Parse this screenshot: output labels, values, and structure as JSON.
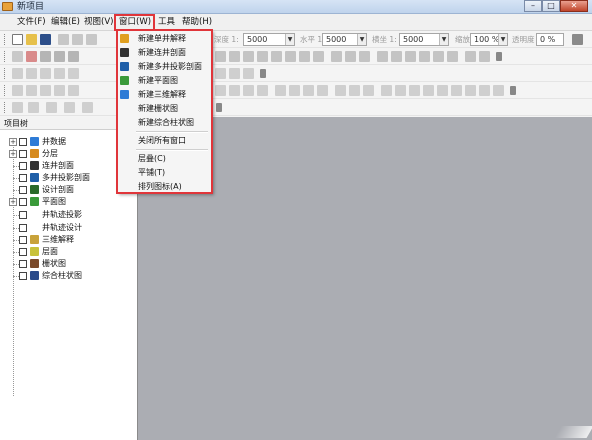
{
  "window": {
    "title": "新项目"
  },
  "menubar": {
    "items": [
      "文件(F)",
      "编辑(E)",
      "视图(V)",
      "窗口(W)",
      "工具",
      "帮助(H)"
    ]
  },
  "toolbar": {
    "combo_1_label": "深度 1:",
    "combo_1_value": "5000",
    "combo_2_label": "水平 1:",
    "combo_2_value": "5000",
    "combo_3_label": "横坐 1:",
    "combo_3_value": "5000",
    "zoom_label": "缩放",
    "zoom_value": "100 %",
    "transparency_label": "透明度",
    "transparency_value": "0 %"
  },
  "project_tree": {
    "title": "项目树",
    "items": [
      {
        "label": "井数据",
        "icon": "well-data-icon",
        "color": "#2e7bd6",
        "expandable": true
      },
      {
        "label": "分层",
        "icon": "layer-icon",
        "color": "#d68a1e",
        "expandable": true
      },
      {
        "label": "连井剖面",
        "icon": "well-section-icon",
        "color": "#333333",
        "expandable": false
      },
      {
        "label": "多井投影剖面",
        "icon": "multi-well-section-icon",
        "color": "#1f5fa8",
        "expandable": false
      },
      {
        "label": "设计剖面",
        "icon": "design-section-icon",
        "color": "#2a6a2a",
        "expandable": false
      },
      {
        "label": "平面图",
        "icon": "plan-map-icon",
        "color": "#3a9a3a",
        "expandable": true
      },
      {
        "label": "井轨迹投影",
        "icon": "",
        "color": "",
        "expandable": false
      },
      {
        "label": "井轨迹设计",
        "icon": "",
        "color": "",
        "expandable": false
      },
      {
        "label": "三维解释",
        "icon": "3d-interpret-icon",
        "color": "#c8a23a",
        "expandable": false
      },
      {
        "label": "层面",
        "icon": "horizon-icon",
        "color": "#c8c23a",
        "expandable": false
      },
      {
        "label": "栅状图",
        "icon": "fence-icon",
        "color": "#7a4a2a",
        "expandable": false
      },
      {
        "label": "综合柱状图",
        "icon": "composite-column-icon",
        "color": "#2a4a8a",
        "expandable": false
      }
    ]
  },
  "window_menu": {
    "items": [
      {
        "label": "新建单井解释",
        "icon": "single-well-icon",
        "color": "#e0a020"
      },
      {
        "label": "新建连井剖面",
        "icon": "well-section-icon",
        "color": "#333333"
      },
      {
        "label": "新建多井投影剖面",
        "icon": "multi-well-section-icon",
        "color": "#1f5fa8"
      },
      {
        "label": "新建平面图",
        "icon": "plan-map-icon",
        "color": "#3a9a3a"
      },
      {
        "label": "新建三维解释",
        "icon": "3d-interpret-icon",
        "color": "#2e7bd6"
      },
      {
        "label": "新建栅状图",
        "icon": "",
        "color": ""
      },
      {
        "label": "新建综合柱状图",
        "icon": "",
        "color": ""
      },
      {
        "label": "关闭所有窗口",
        "icon": "",
        "color": ""
      },
      {
        "label": "层叠(C)",
        "icon": "",
        "color": ""
      },
      {
        "label": "平铺(T)",
        "icon": "",
        "color": ""
      },
      {
        "label": "排列图标(A)",
        "icon": "",
        "color": ""
      }
    ]
  },
  "colors": {
    "highlight": "#e0353a",
    "workspace": "#abadb3"
  }
}
